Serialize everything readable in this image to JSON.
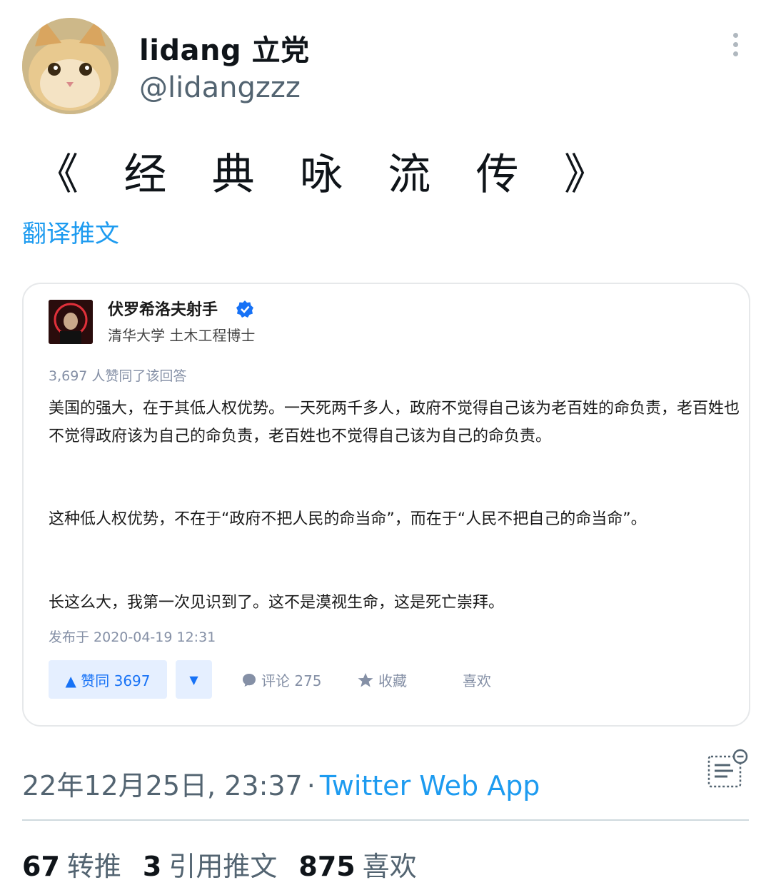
{
  "tweet": {
    "author": {
      "display_name": "lidang 立党",
      "handle": "@lidangzzz"
    },
    "text_chars": [
      "《",
      "经",
      "典",
      "咏",
      "流",
      "传",
      "》"
    ],
    "translate_label": "翻译推文",
    "timestamp": "22年12月25日, 23:37",
    "separator": "·",
    "source": "Twitter Web App",
    "stats": {
      "retweets": {
        "count": "67",
        "label": "转推"
      },
      "quotes": {
        "count": "3",
        "label": "引用推文"
      },
      "likes": {
        "count": "875",
        "label": "喜欢"
      }
    }
  },
  "image_card": {
    "author": "伏罗希洛夫射手",
    "headline": "清华大学 土木工程博士",
    "likes_summary": "3,697 人赞同了该回答",
    "paragraphs": [
      "美国的强大，在于其低人权优势。一天死两千多人，政府不觉得自己该为老百姓的命负责，老百姓也不觉得政府该为自己的命负责，老百姓也不觉得自己该为自己的命负责。",
      "这种低人权优势，不在于“政府不把人民的命当命”，而在于“人民不把自己的命当命”。",
      "长这么大，我第一次见识到了。这不是漠视生命，这是死亡崇拜。"
    ],
    "date": "发布于 2020-04-19 12:31",
    "upvote_label": "▲ 赞同 3697",
    "downvote_label": "▼",
    "comments_label": "评论 275",
    "favorite_label": "收藏",
    "like_label": "喜欢"
  },
  "icons": [
    "more-icon",
    "verified-icon",
    "comment-icon",
    "star-icon",
    "analytics-icon"
  ],
  "colors": {
    "link": "#1d9bf0",
    "secondary_text": "#536471",
    "zhihu_blue": "#1772f6"
  }
}
